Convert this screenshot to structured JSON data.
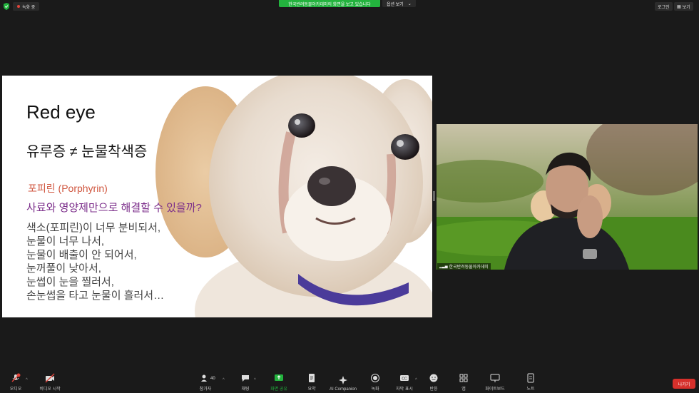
{
  "topbar": {
    "recording_label": "녹화 중",
    "share_banner": "한국반려동물아카데미의 화면을 보고 있습니다",
    "view_options": "옵션 보기",
    "login": "로그인",
    "view": "보기"
  },
  "slide": {
    "title": "Red eye",
    "subtitle": "유루증 ≠ 눈물착색증",
    "porphyrin": "포피린 (Porphyrin)",
    "question": "사료와 영양제만으로 해결할 수 있을까?",
    "lines": [
      "색소(포피린)이 너무 분비되서,",
      "눈물이 너무 나서,",
      "눈물이 배출이 안 되어서,",
      "눈꺼풀이 낮아서,",
      "눈썹이 눈을 찔러서,",
      "손눈썹을 타고 눈물이 흘러서…"
    ]
  },
  "participant": {
    "name": "한국반려동물아카데미"
  },
  "toolbar": {
    "audio": "오디오",
    "video": "비디오 시작",
    "participants": "참가자",
    "participant_count": "40",
    "chat": "채팅",
    "share": "화면 공유",
    "summary": "요약",
    "ai": "AI Companion",
    "record": "녹화",
    "captions": "자막 표시",
    "reactions": "반응",
    "apps": "앱",
    "whiteboard": "화이트보드",
    "notes": "노트",
    "leave": "나가기"
  },
  "colors": {
    "share_green": "#23b33e",
    "leave_red": "#d6302b",
    "porphyrin_orange": "#d0563f",
    "question_purple": "#7b2d8a"
  }
}
